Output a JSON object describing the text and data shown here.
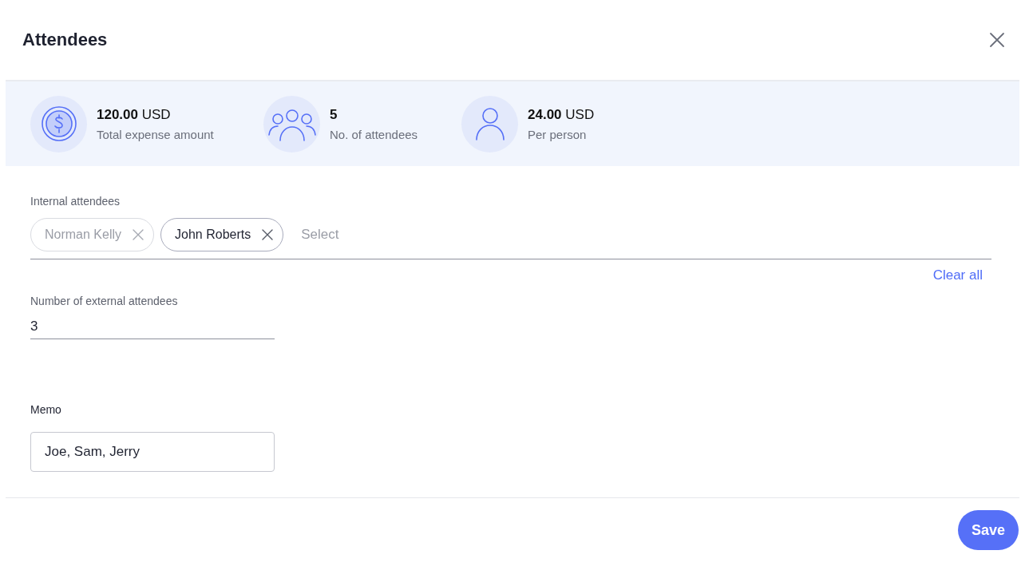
{
  "dialog": {
    "title": "Attendees"
  },
  "summary": [
    {
      "kind": "money",
      "value": "**120.00** USD",
      "label": "Total expense amount"
    },
    {
      "kind": "group",
      "value": "**5**",
      "label": "No. of attendees"
    },
    {
      "kind": "person",
      "value": "**24.00** USD",
      "label": "Per person"
    }
  ],
  "internal_attendees": {
    "label": "Internal attendees",
    "chips": [
      {
        "name": "Norman Kelly",
        "disabled": true
      },
      {
        "name": "John Roberts",
        "disabled": false
      }
    ],
    "placeholder": "Select",
    "clear_link": "Clear all"
  },
  "external_attendees": {
    "label": "Number of external attendees",
    "value": "3"
  },
  "memo": {
    "label": "Memo",
    "value": "Joe, Sam, Jerry"
  },
  "buttons": [
    "Save"
  ]
}
